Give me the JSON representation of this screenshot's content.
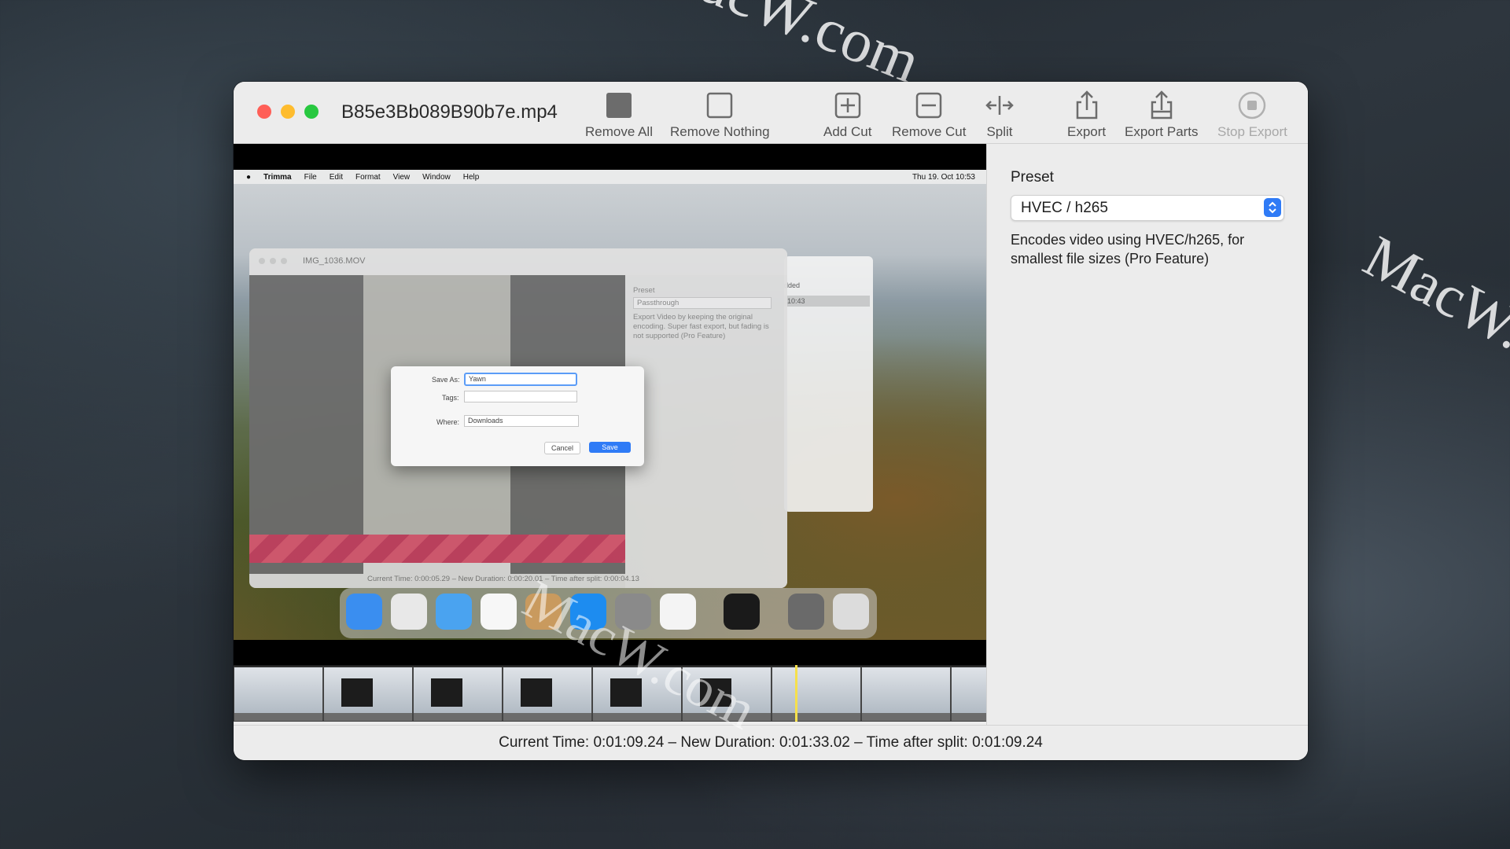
{
  "watermark": "MacW.com",
  "window": {
    "title": "B85e3Bb089B90b7e.mp4"
  },
  "toolbar": {
    "remove_all": "Remove All",
    "remove_nothing": "Remove Nothing",
    "add_cut": "Add Cut",
    "remove_cut": "Remove Cut",
    "split": "Split",
    "export": "Export",
    "export_parts": "Export Parts",
    "stop_export": "Stop Export"
  },
  "sidebar": {
    "preset_label": "Preset",
    "preset_value": "HVEC / h265",
    "preset_description": "Encodes video using HVEC/h265, for smallest file sizes (Pro Feature)"
  },
  "status": {
    "text": "Current Time: 0:01:09.24 – New Duration: 0:01:33.02 – Time after split: 0:01:09.24"
  },
  "video_content": {
    "menubar": {
      "app": "Trimma",
      "items": [
        "File",
        "Edit",
        "Format",
        "View",
        "Window",
        "Help"
      ],
      "clock": "Thu 19. Oct 10:53"
    },
    "inner_window_title": "IMG_1036.MOV",
    "inner_preset_label": "Preset",
    "inner_preset_value": "Passthrough",
    "inner_preset_desc": "Export Video by keeping the original encoding. Super fast export, but fading is not supported (Pro Feature)",
    "inner_status": "Current Time: 0:00:05.29 – New Duration: 0:00:20.01 – Time after split: 0:00:04.13",
    "side_panel_header": "dded",
    "side_panel_time": "10:43",
    "dialog": {
      "save_as_label": "Save As:",
      "save_as_value": "Yawn",
      "tags_label": "Tags:",
      "where_label": "Where:",
      "where_value": "Downloads",
      "cancel": "Cancel",
      "save": "Save"
    }
  },
  "colors": {
    "accent": "#2f7bf6",
    "playhead": "#f6e04c",
    "close": "#ff5f57",
    "minimize": "#febc2e",
    "maximize": "#28c840"
  }
}
